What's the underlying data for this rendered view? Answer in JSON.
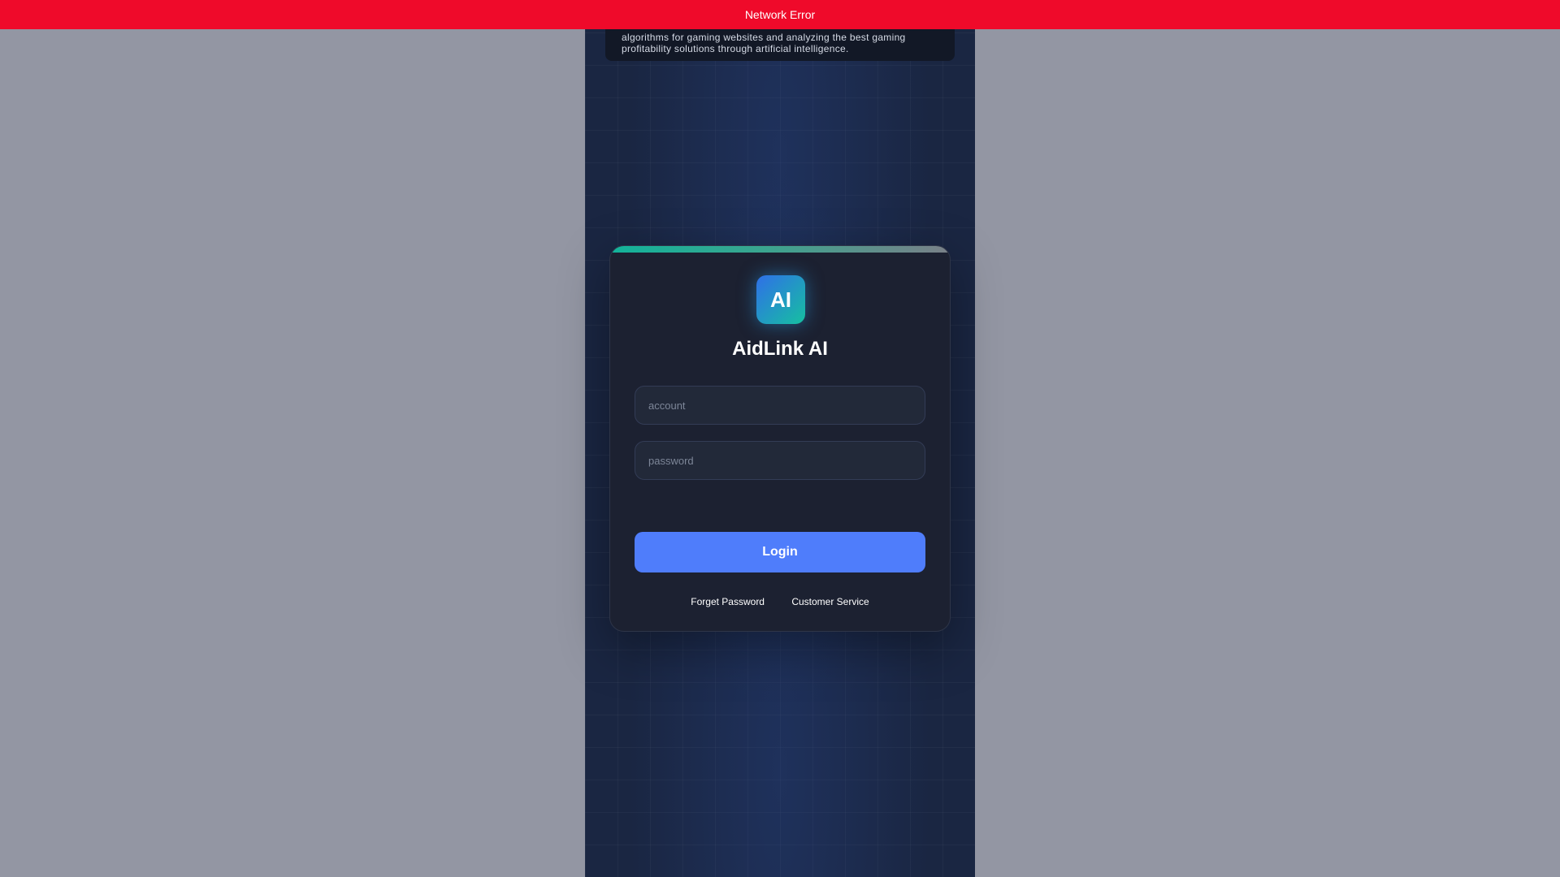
{
  "error_banner": {
    "text": "Network Error",
    "color": "#ef0a2a"
  },
  "notice": {
    "text": "algorithms for gaming websites and analyzing the best gaming profitability solutions through artificial intelligence."
  },
  "login": {
    "logo_text": "AI",
    "app_name": "AidLink AI",
    "account_placeholder": "account",
    "password_placeholder": "password",
    "login_label": "Login",
    "forget_password_label": "Forget Password",
    "customer_service_label": "Customer Service"
  },
  "colors": {
    "accent_button": "#4f7dfb",
    "card_background": "#1c2131",
    "page_background": "#1a2642",
    "overlay_background": "#9396a3",
    "logo_gradient_start": "#2f6fe8",
    "logo_gradient_end": "#16c0a0"
  }
}
